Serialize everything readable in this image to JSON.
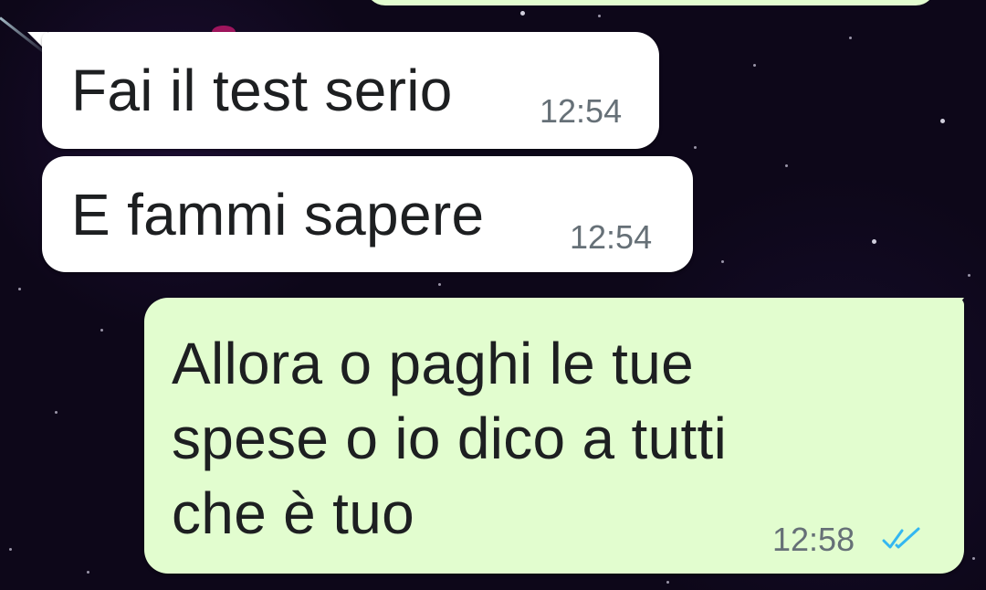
{
  "chat": {
    "messages": [
      {
        "direction": "incoming",
        "text": "Fai il test serio",
        "time": "12:54"
      },
      {
        "direction": "incoming",
        "text": "E fammi sapere",
        "time": "12:54"
      },
      {
        "direction": "outgoing",
        "lines": [
          "Allora o paghi le tue",
          "spese o io dico a tutti",
          "che è tuo"
        ],
        "time": "12:58",
        "status": "read"
      }
    ]
  },
  "colors": {
    "incoming_bubble": "#ffffff",
    "outgoing_bubble": "#e2fdcf",
    "read_ticks": "#34b7f1",
    "background": "#0d0719"
  },
  "icons": {
    "read_status": "double-check-icon"
  }
}
